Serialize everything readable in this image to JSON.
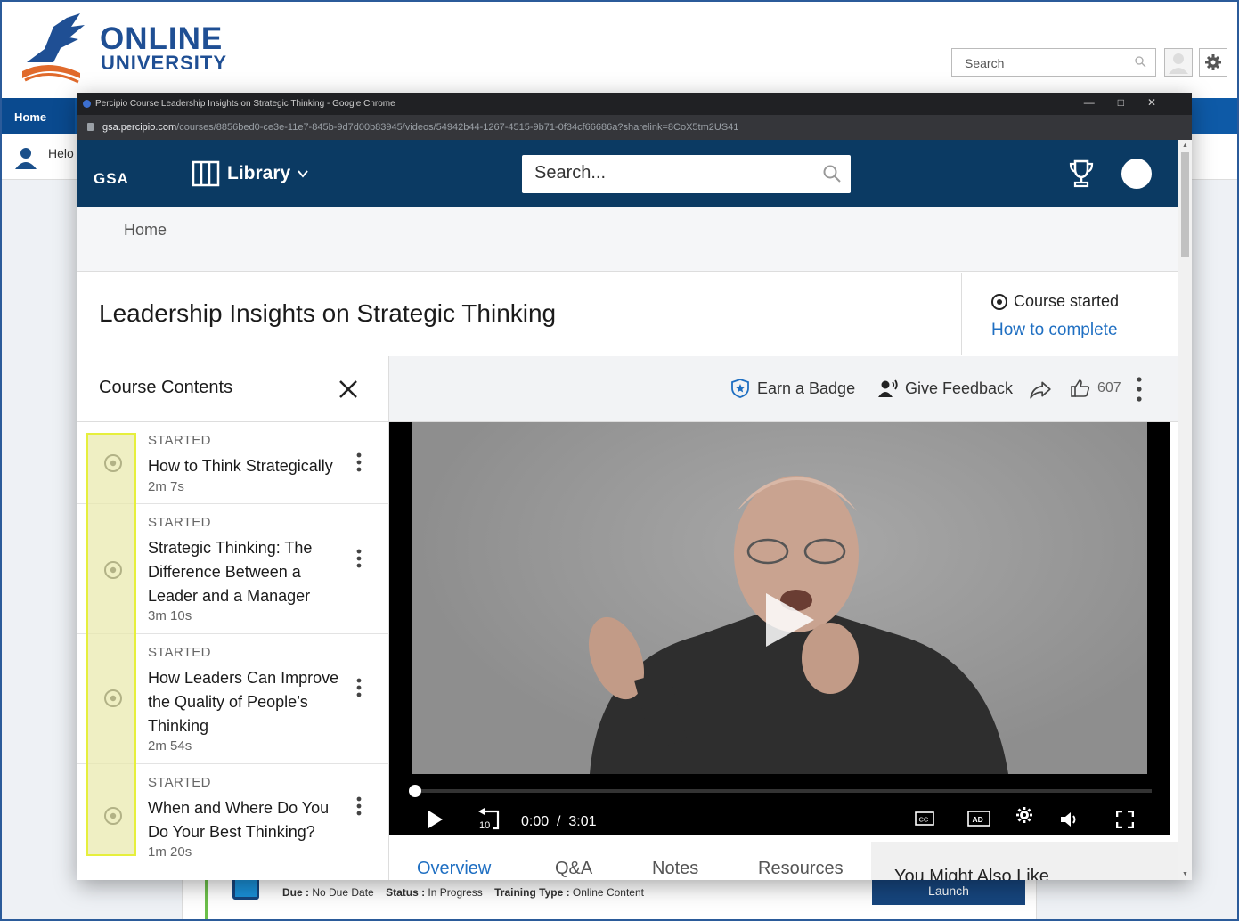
{
  "lms": {
    "logo_line1": "ONLINE",
    "logo_line2": "UNIVERSITY",
    "search_placeholder": "Search",
    "nav_home": "Home",
    "hello": "Helo",
    "meta": {
      "due_label": "Due :",
      "due_value": "No Due Date",
      "status_label": "Status :",
      "status_value": "In Progress",
      "type_label": "Training Type :",
      "type_value": "Online Content"
    },
    "launch": "Launch"
  },
  "browser": {
    "window_title": "Percipio Course Leadership Insights on Strategic Thinking - Google Chrome",
    "url_host": "gsa.percipio.com",
    "url_path": "/courses/8856bed0-ce3e-11e7-845b-9d7d00b83945/videos/54942b44-1267-4515-9b71-0f34cf66686a?sharelink=8CoX5tm2US41"
  },
  "percipio": {
    "brand": "GSA",
    "library": "Library",
    "search_placeholder": "Search...",
    "breadcrumb": "Home",
    "course_title": "Leadership Insights on Strategic Thinking",
    "course_status": "Course started",
    "how_to_complete": "How to complete",
    "contents_title": "Course Contents",
    "items": [
      {
        "status": "STARTED",
        "title": "How to Think Strategically",
        "duration": "2m 7s"
      },
      {
        "status": "STARTED",
        "title": "Strategic Thinking: The Difference Between a Leader and a Manager",
        "duration": "3m 10s"
      },
      {
        "status": "STARTED",
        "title": "How Leaders Can Improve the Quality of People’s Thinking",
        "duration": "2m 54s"
      },
      {
        "status": "STARTED",
        "title": "When and Where Do You Do Your Best Thinking?",
        "duration": "1m 20s"
      }
    ],
    "toolbar": {
      "badge": "Earn a Badge",
      "feedback": "Give Feedback",
      "likes": "607"
    },
    "player": {
      "current_time": "0:00",
      "separator": "/",
      "duration": "3:01",
      "progress": 0,
      "skip_back_seconds": "10"
    },
    "tabs": [
      "Overview",
      "Q&A",
      "Notes",
      "Resources"
    ],
    "active_tab": "Overview",
    "you_might_also_like": "You Might Also Like"
  },
  "colors": {
    "percipio_header": "#0b3a63",
    "link_blue": "#1f6fc2",
    "lms_nav": "#0e5aa7",
    "highlight_border": "#e6ef3c"
  }
}
